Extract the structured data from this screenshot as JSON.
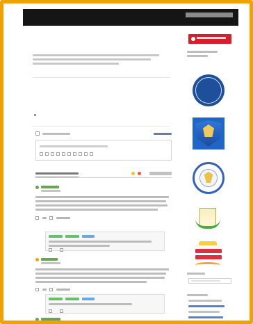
{
  "app": {
    "title": ""
  },
  "top_nav": {
    "items": [
      {
        "label": ""
      },
      {
        "label": ""
      },
      {
        "label": ""
      },
      {
        "label": ""
      },
      {
        "label": ""
      },
      {
        "label": ""
      },
      {
        "label": ""
      },
      {
        "label": ""
      }
    ]
  },
  "page": {
    "title": ""
  },
  "comments": {
    "count_label": "",
    "sort_label": ""
  },
  "sidebar": {
    "top_button_label": "",
    "blocks": [
      {
        "name": ""
      },
      {
        "name": ""
      },
      {
        "name": ""
      },
      {
        "name": ""
      },
      {
        "name": ""
      }
    ]
  },
  "colors": {
    "frame": "#f0a300",
    "nav": "#151515",
    "accent_red": "#d71e2c",
    "author_green": "#6aa35a",
    "link_blue": "#5b7fd0"
  },
  "icons": {
    "avatar": "avatar-icon",
    "sort": "sort-icon",
    "reply": "reply-icon",
    "like": "like-icon",
    "dislike": "dislike-icon",
    "search": "search-icon"
  }
}
